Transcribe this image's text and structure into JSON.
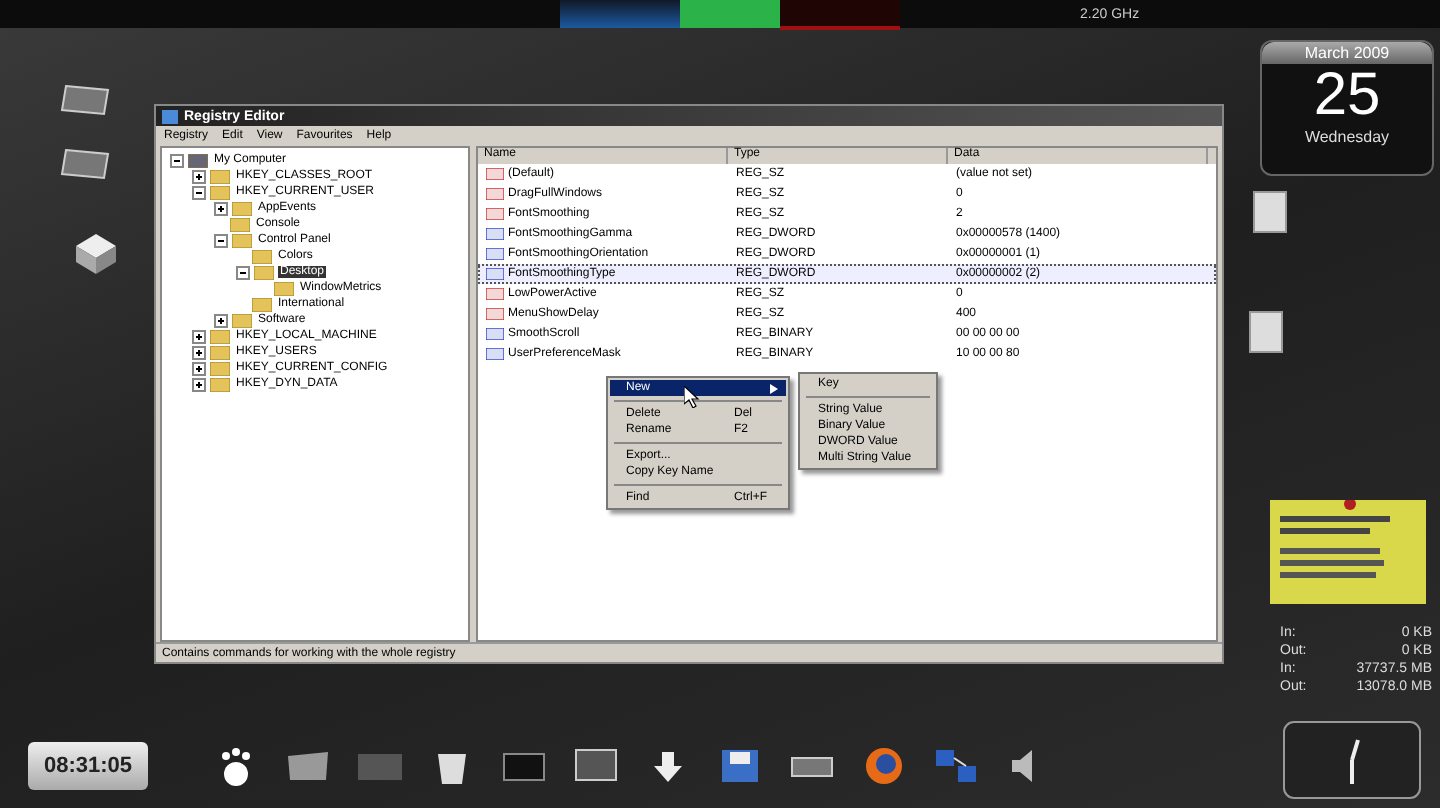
{
  "top_panel": {
    "cpu": "2.20 GHz"
  },
  "window": {
    "title": "Registry Editor",
    "menu": [
      "Registry",
      "Edit",
      "View",
      "Favourites",
      "Help"
    ],
    "tree": [
      {
        "label": "My Computer",
        "expanded": true,
        "selected": false,
        "children": [
          {
            "label": "HKEY_CLASSES_ROOT",
            "expanded": false,
            "selected": false
          },
          {
            "label": "HKEY_CURRENT_USER",
            "expanded": true,
            "selected": false,
            "children": [
              {
                "label": "AppEvents",
                "expanded": false,
                "selected": false
              },
              {
                "label": "Console",
                "selected": false
              },
              {
                "label": "Control Panel",
                "expanded": true,
                "selected": false,
                "children": [
                  {
                    "label": "Colors",
                    "selected": false
                  },
                  {
                    "label": "Desktop",
                    "expanded": true,
                    "selected": true,
                    "children": [
                      {
                        "label": "WindowMetrics",
                        "selected": false
                      }
                    ]
                  },
                  {
                    "label": "International",
                    "selected": false
                  }
                ]
              },
              {
                "label": "Software",
                "expanded": false,
                "selected": false
              }
            ]
          },
          {
            "label": "HKEY_LOCAL_MACHINE",
            "expanded": false,
            "selected": false
          },
          {
            "label": "HKEY_USERS",
            "expanded": false,
            "selected": false
          },
          {
            "label": "HKEY_CURRENT_CONFIG",
            "expanded": false,
            "selected": false
          },
          {
            "label": "HKEY_DYN_DATA",
            "expanded": false,
            "selected": false
          }
        ]
      }
    ],
    "columns": [
      "Name",
      "Type",
      "Data"
    ],
    "values": [
      {
        "kind": "string",
        "name": "(Default)",
        "type": "REG_SZ",
        "data": "(value not set)",
        "selected": false
      },
      {
        "kind": "string",
        "name": "DragFullWindows",
        "type": "REG_SZ",
        "data": "0",
        "selected": false
      },
      {
        "kind": "string",
        "name": "FontSmoothing",
        "type": "REG_SZ",
        "data": "2",
        "selected": false
      },
      {
        "kind": "binary",
        "name": "FontSmoothingGamma",
        "type": "REG_DWORD",
        "data": "0x00000578 (1400)",
        "selected": false
      },
      {
        "kind": "binary",
        "name": "FontSmoothingOrientation",
        "type": "REG_DWORD",
        "data": "0x00000001 (1)",
        "selected": false
      },
      {
        "kind": "binary",
        "name": "FontSmoothingType",
        "type": "REG_DWORD",
        "data": "0x00000002 (2)",
        "selected": true
      },
      {
        "kind": "string",
        "name": "LowPowerActive",
        "type": "REG_SZ",
        "data": "0",
        "selected": false
      },
      {
        "kind": "string",
        "name": "MenuShowDelay",
        "type": "REG_SZ",
        "data": "400",
        "selected": false
      },
      {
        "kind": "binary",
        "name": "SmoothScroll",
        "type": "REG_BINARY",
        "data": "00 00 00 00",
        "selected": false
      },
      {
        "kind": "binary",
        "name": "UserPreferenceMask",
        "type": "REG_BINARY",
        "data": "10 00 00 80",
        "selected": false
      }
    ],
    "status": "Contains commands for working with the whole registry"
  },
  "context_menu": [
    {
      "kind": "item",
      "label": "New",
      "submenu": true,
      "selected": true
    },
    {
      "kind": "separator"
    },
    {
      "kind": "item",
      "label": "Delete",
      "shortcut": "Del",
      "submenu": false,
      "selected": false
    },
    {
      "kind": "item",
      "label": "Rename",
      "shortcut": "F2",
      "submenu": false,
      "selected": false
    },
    {
      "kind": "separator"
    },
    {
      "kind": "item",
      "label": "Export...",
      "submenu": false,
      "selected": false
    },
    {
      "kind": "item",
      "label": "Copy Key Name",
      "submenu": false,
      "selected": false
    },
    {
      "kind": "separator"
    },
    {
      "kind": "item",
      "label": "Find",
      "shortcut": "Ctrl+F",
      "submenu": false,
      "selected": false
    }
  ],
  "submenu": [
    {
      "kind": "item",
      "label": "Key"
    },
    {
      "kind": "separator"
    },
    {
      "kind": "item",
      "label": "String Value"
    },
    {
      "kind": "item",
      "label": "Binary Value"
    },
    {
      "kind": "item",
      "label": "DWORD Value"
    },
    {
      "kind": "item",
      "label": "Multi String Value"
    }
  ],
  "calendar": {
    "month": "March 2009",
    "day": "25",
    "weekday": "Wednesday"
  },
  "network": [
    {
      "label": "In:",
      "value": "0 KB"
    },
    {
      "label": "Out:",
      "value": "0 KB"
    },
    {
      "label": "In:",
      "value": "37737.5 MB"
    },
    {
      "label": "Out:",
      "value": "13078.0 MB"
    }
  ],
  "clock": {
    "time": "08:31:05"
  }
}
